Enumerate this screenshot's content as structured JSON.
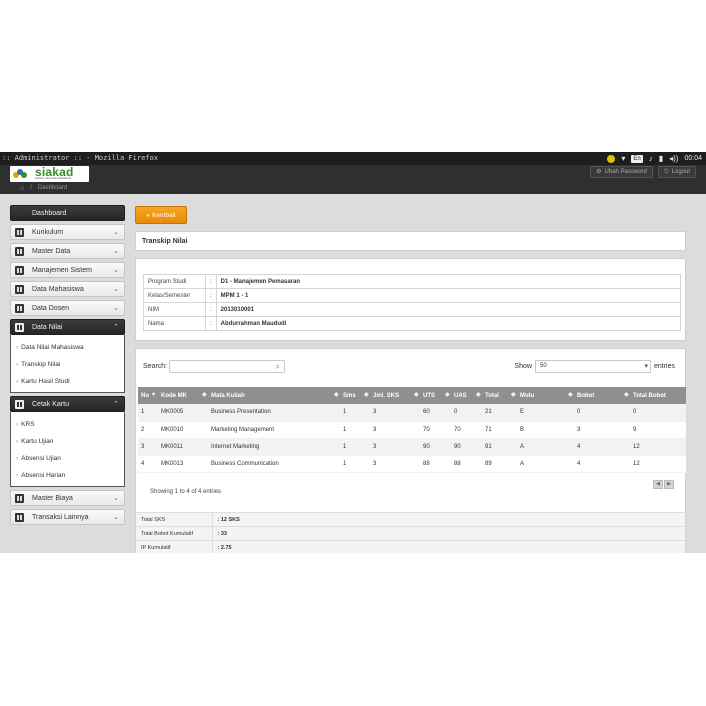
{
  "window": {
    "title": ":: Administrator :: - Mozilla Firefox",
    "tray": {
      "lang": "En",
      "volume": "◂))",
      "time": "00:04"
    }
  },
  "app": {
    "logo_text": "siakad",
    "logo_tagline": "Sistem Informasi Akademik",
    "top_buttons": [
      "Ubah Password",
      "Logout"
    ],
    "breadcrumb": [
      "Dashboard"
    ]
  },
  "sidebar": {
    "items": [
      {
        "label": "Dashboard",
        "state": "active"
      },
      {
        "label": "Kurikulum"
      },
      {
        "label": "Master Data"
      },
      {
        "label": "Manajemen Sistem"
      },
      {
        "label": "Data Mahasiswa"
      },
      {
        "label": "Data Dosen"
      },
      {
        "label": "Data Nilai",
        "expanded": true
      },
      {
        "label": "Cetak Kartu",
        "expanded": true
      },
      {
        "label": "Master Biaya"
      },
      {
        "label": "Transaksi Lainnya"
      }
    ],
    "data_nilai_sub": [
      "Data Nilai Mahasiswa",
      "Transkip Nilai",
      "Kartu Hasil Studi"
    ],
    "cetak_kartu_sub": [
      "KRS",
      "Kartu Ujian",
      "Absensi Ujian",
      "Absensi Harian"
    ]
  },
  "main": {
    "back_label": "Kembali",
    "panel_title": "Transkip Nilai",
    "info": [
      {
        "label": "Program Studi",
        "value": "D1 - Manajemen Pemasaran"
      },
      {
        "label": "Kelas/Semester",
        "value": "MPM 1 - 1"
      },
      {
        "label": "NIM",
        "value": "2013010001"
      },
      {
        "label": "Nama",
        "value": "Abdurrahman Maududi"
      }
    ],
    "search_label": "Search:",
    "show_label": "Show",
    "show_value": "50",
    "entries_label": "entries",
    "columns": [
      "No",
      "Kode MK",
      "Mata Kuliah",
      "Sms",
      "Jml. SKS",
      "UTS",
      "UAS",
      "Total",
      "Mutu",
      "Bobot",
      "Total Bobot"
    ],
    "rows": [
      [
        "1",
        "MK0005",
        "Business Presentation",
        "1",
        "3",
        "60",
        "0",
        "21",
        "E",
        "0",
        "0"
      ],
      [
        "2",
        "MK0010",
        "Marketing Management",
        "1",
        "3",
        "70",
        "70",
        "71",
        "B",
        "3",
        "9"
      ],
      [
        "3",
        "MK0011",
        "Internet Marketing",
        "1",
        "3",
        "90",
        "90",
        "91",
        "A",
        "4",
        "12"
      ],
      [
        "4",
        "MK0013",
        "Business Communication",
        "1",
        "3",
        "88",
        "88",
        "89",
        "A",
        "4",
        "12"
      ]
    ],
    "showing_text": "Showing 1 to 4 of 4 entries",
    "totals": [
      {
        "label": "Total SKS",
        "value": ": 12 SKS"
      },
      {
        "label": "Total Bobot Kumulatif",
        "value": ": 33"
      },
      {
        "label": "IP Kumulatif",
        "value": ": 2.75"
      }
    ]
  },
  "colors": {
    "accent_orange": "#f0951a",
    "table_header": "#8f8f8f",
    "sidebar_dark": "#2e2e2e",
    "logo_green": "#3c8a2e"
  }
}
